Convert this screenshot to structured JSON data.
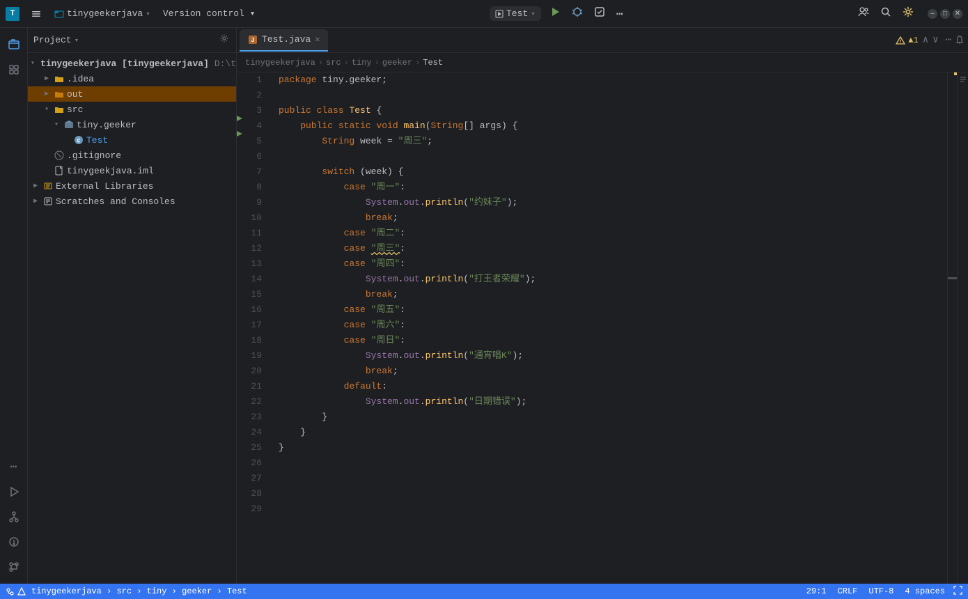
{
  "titlebar": {
    "logo": "T",
    "project_name": "tinygeekerjava",
    "project_arrow": "▾",
    "menu_items": [
      "☰",
      "Version control ▾"
    ],
    "run_config": "Test",
    "run_config_arrow": "▾",
    "btn_run_icon": "▶",
    "btn_debug_icon": "🐛",
    "btn_more_icon": "...",
    "right_icons": [
      "👤",
      "🔍",
      "⚙",
      "..."
    ],
    "window_min": "–",
    "window_max": "□",
    "window_close": "✕"
  },
  "project_panel": {
    "title": "Project",
    "title_arrow": "▾",
    "tree": [
      {
        "label": "tinygeekerjava [tinygeekerjava]",
        "path": "D:\\tinyge...",
        "type": "root",
        "indent": 0,
        "expanded": true
      },
      {
        "label": ".idea",
        "type": "folder",
        "indent": 1,
        "expanded": false
      },
      {
        "label": "out",
        "type": "folder-orange",
        "indent": 1,
        "expanded": false,
        "selected": true
      },
      {
        "label": "src",
        "type": "folder-src",
        "indent": 1,
        "expanded": true
      },
      {
        "label": "tiny.geeker",
        "type": "package",
        "indent": 2,
        "expanded": true
      },
      {
        "label": "Test",
        "type": "class",
        "indent": 3
      },
      {
        "label": ".gitignore",
        "type": "git",
        "indent": 1
      },
      {
        "label": "tinygeekjava.iml",
        "type": "iml",
        "indent": 1
      },
      {
        "label": "External Libraries",
        "type": "library",
        "indent": 0,
        "expanded": false
      },
      {
        "label": "Scratches and Consoles",
        "type": "scratches",
        "indent": 0
      }
    ]
  },
  "editor": {
    "tab_name": "Test.java",
    "tab_icon": "J",
    "warning_count": "▲1",
    "breadcrumbs": [
      "tinygeekerjava",
      "src",
      "tiny",
      "geeker",
      "Test"
    ],
    "lines": [
      {
        "num": 1,
        "code": "package tiny.geeker;",
        "tokens": [
          {
            "t": "package",
            "c": "kw"
          },
          {
            "t": " tiny.geeker;",
            "c": "var"
          }
        ]
      },
      {
        "num": 2,
        "code": "",
        "tokens": []
      },
      {
        "num": 3,
        "code": "public class Test {",
        "tokens": [
          {
            "t": "public ",
            "c": "kw"
          },
          {
            "t": "class ",
            "c": "kw"
          },
          {
            "t": "Test",
            "c": "cls"
          },
          {
            "t": " {",
            "c": "punc"
          }
        ],
        "run": true
      },
      {
        "num": 4,
        "code": "    public static void main(String[] args) {",
        "tokens": [
          {
            "t": "    ",
            "c": "var"
          },
          {
            "t": "public ",
            "c": "kw"
          },
          {
            "t": "static ",
            "c": "kw"
          },
          {
            "t": "void ",
            "c": "kw"
          },
          {
            "t": "main",
            "c": "fn"
          },
          {
            "t": "(",
            "c": "punc"
          },
          {
            "t": "String",
            "c": "type"
          },
          {
            "t": "[] ",
            "c": "var"
          },
          {
            "t": "args",
            "c": "param"
          },
          {
            "t": ") {",
            "c": "punc"
          }
        ],
        "run": true
      },
      {
        "num": 5,
        "code": "        String week = \"周三\";",
        "tokens": [
          {
            "t": "        ",
            "c": "var"
          },
          {
            "t": "String ",
            "c": "type"
          },
          {
            "t": "week",
            "c": "var"
          },
          {
            "t": " = ",
            "c": "punc"
          },
          {
            "t": "\"周三\"",
            "c": "str"
          },
          {
            "t": ";",
            "c": "punc"
          }
        ]
      },
      {
        "num": 6,
        "code": "",
        "tokens": []
      },
      {
        "num": 7,
        "code": "        switch (week) {",
        "tokens": [
          {
            "t": "        ",
            "c": "var"
          },
          {
            "t": "switch ",
            "c": "kw"
          },
          {
            "t": "(week) {",
            "c": "var"
          }
        ]
      },
      {
        "num": 8,
        "code": "            case \"周一\":",
        "tokens": [
          {
            "t": "            ",
            "c": "var"
          },
          {
            "t": "case ",
            "c": "kw"
          },
          {
            "t": "\"周一\"",
            "c": "str"
          },
          {
            "t": ":",
            "c": "punc"
          }
        ]
      },
      {
        "num": 9,
        "code": "                System.out.println(\"约妹子\");",
        "tokens": [
          {
            "t": "                ",
            "c": "var"
          },
          {
            "t": "System",
            "c": "sys"
          },
          {
            "t": ".",
            "c": "punc"
          },
          {
            "t": "out",
            "c": "field"
          },
          {
            "t": ".",
            "c": "punc"
          },
          {
            "t": "println",
            "c": "fn"
          },
          {
            "t": "(",
            "c": "punc"
          },
          {
            "t": "\"约妹子\"",
            "c": "str"
          },
          {
            "t": ");",
            "c": "punc"
          }
        ]
      },
      {
        "num": 10,
        "code": "                break;",
        "tokens": [
          {
            "t": "                ",
            "c": "var"
          },
          {
            "t": "break",
            "c": "kw"
          },
          {
            "t": ";",
            "c": "punc"
          }
        ]
      },
      {
        "num": 11,
        "code": "            case \"周二\":",
        "tokens": [
          {
            "t": "            ",
            "c": "var"
          },
          {
            "t": "case ",
            "c": "kw"
          },
          {
            "t": "\"周二\"",
            "c": "str"
          },
          {
            "t": ":",
            "c": "punc"
          }
        ]
      },
      {
        "num": 12,
        "code": "            case \"周三\":",
        "tokens": [
          {
            "t": "            ",
            "c": "var"
          },
          {
            "t": "case ",
            "c": "kw"
          },
          {
            "t": "\"周三\"",
            "c": "str"
          },
          {
            "t": ":",
            "c": "punc"
          }
        ]
      },
      {
        "num": 13,
        "code": "            case \"周四\":",
        "tokens": [
          {
            "t": "            ",
            "c": "var"
          },
          {
            "t": "case ",
            "c": "kw"
          },
          {
            "t": "\"周四\"",
            "c": "str"
          },
          {
            "t": ":",
            "c": "punc"
          }
        ]
      },
      {
        "num": 14,
        "code": "                System.out.println(\"打王者荣耀\");",
        "tokens": [
          {
            "t": "                ",
            "c": "var"
          },
          {
            "t": "System",
            "c": "sys"
          },
          {
            "t": ".",
            "c": "punc"
          },
          {
            "t": "out",
            "c": "field"
          },
          {
            "t": ".",
            "c": "punc"
          },
          {
            "t": "println",
            "c": "fn"
          },
          {
            "t": "(",
            "c": "punc"
          },
          {
            "t": "\"打王者荣耀\"",
            "c": "str"
          },
          {
            "t": ");",
            "c": "punc"
          }
        ]
      },
      {
        "num": 15,
        "code": "                break;",
        "tokens": [
          {
            "t": "                ",
            "c": "var"
          },
          {
            "t": "break",
            "c": "kw"
          },
          {
            "t": ";",
            "c": "punc"
          }
        ]
      },
      {
        "num": 16,
        "code": "            case \"周五\":",
        "tokens": [
          {
            "t": "            ",
            "c": "var"
          },
          {
            "t": "case ",
            "c": "kw"
          },
          {
            "t": "\"周五\"",
            "c": "str"
          },
          {
            "t": ":",
            "c": "punc"
          }
        ]
      },
      {
        "num": 17,
        "code": "            case \"周六\":",
        "tokens": [
          {
            "t": "            ",
            "c": "var"
          },
          {
            "t": "case ",
            "c": "kw"
          },
          {
            "t": "\"周六\"",
            "c": "str"
          },
          {
            "t": ":",
            "c": "punc"
          }
        ]
      },
      {
        "num": 18,
        "code": "            case \"周日\":",
        "tokens": [
          {
            "t": "            ",
            "c": "var"
          },
          {
            "t": "case ",
            "c": "kw"
          },
          {
            "t": "\"周日\"",
            "c": "str"
          },
          {
            "t": ":",
            "c": "punc"
          }
        ]
      },
      {
        "num": 19,
        "code": "                System.out.println(\"通宵唱K\");",
        "tokens": [
          {
            "t": "                ",
            "c": "var"
          },
          {
            "t": "System",
            "c": "sys"
          },
          {
            "t": ".",
            "c": "punc"
          },
          {
            "t": "out",
            "c": "field"
          },
          {
            "t": ".",
            "c": "punc"
          },
          {
            "t": "println",
            "c": "fn"
          },
          {
            "t": "(",
            "c": "punc"
          },
          {
            "t": "\"通宵唱K\"",
            "c": "str"
          },
          {
            "t": ");",
            "c": "punc"
          }
        ]
      },
      {
        "num": 20,
        "code": "                break;",
        "tokens": [
          {
            "t": "                ",
            "c": "var"
          },
          {
            "t": "break",
            "c": "kw"
          },
          {
            "t": ";",
            "c": "punc"
          }
        ]
      },
      {
        "num": 21,
        "code": "            default:",
        "tokens": [
          {
            "t": "            ",
            "c": "var"
          },
          {
            "t": "default",
            "c": "kw"
          },
          {
            "t": ":",
            "c": "punc"
          }
        ]
      },
      {
        "num": 22,
        "code": "                System.out.println(\"日期错误\");",
        "tokens": [
          {
            "t": "                ",
            "c": "var"
          },
          {
            "t": "System",
            "c": "sys"
          },
          {
            "t": ".",
            "c": "punc"
          },
          {
            "t": "out",
            "c": "field"
          },
          {
            "t": ".",
            "c": "punc"
          },
          {
            "t": "println",
            "c": "fn"
          },
          {
            "t": "(",
            "c": "punc"
          },
          {
            "t": "\"日期错误\"",
            "c": "str"
          },
          {
            "t": ");",
            "c": "punc"
          }
        ]
      },
      {
        "num": 23,
        "code": "        }",
        "tokens": [
          {
            "t": "        }",
            "c": "punc"
          }
        ]
      },
      {
        "num": 24,
        "code": "    }",
        "tokens": [
          {
            "t": "    }",
            "c": "punc"
          }
        ]
      },
      {
        "num": 25,
        "code": "}",
        "tokens": [
          {
            "t": "}",
            "c": "punc"
          }
        ]
      },
      {
        "num": 26,
        "code": "",
        "tokens": []
      },
      {
        "num": 27,
        "code": "",
        "tokens": []
      },
      {
        "num": 28,
        "code": "",
        "tokens": []
      },
      {
        "num": 29,
        "code": "",
        "tokens": []
      }
    ]
  },
  "statusbar": {
    "project": "tinygeekerjava",
    "src": "src",
    "tiny": "tiny",
    "geeker": "geeker",
    "test": "Test",
    "position": "29:1",
    "line_ending": "CRLF",
    "encoding": "UTF-8",
    "indent": "4 spaces"
  },
  "sidebar_icons": {
    "top": [
      "📁",
      "☆",
      "•••"
    ],
    "bottom": [
      "▶",
      "📋",
      "⚠",
      "⎇"
    ]
  }
}
